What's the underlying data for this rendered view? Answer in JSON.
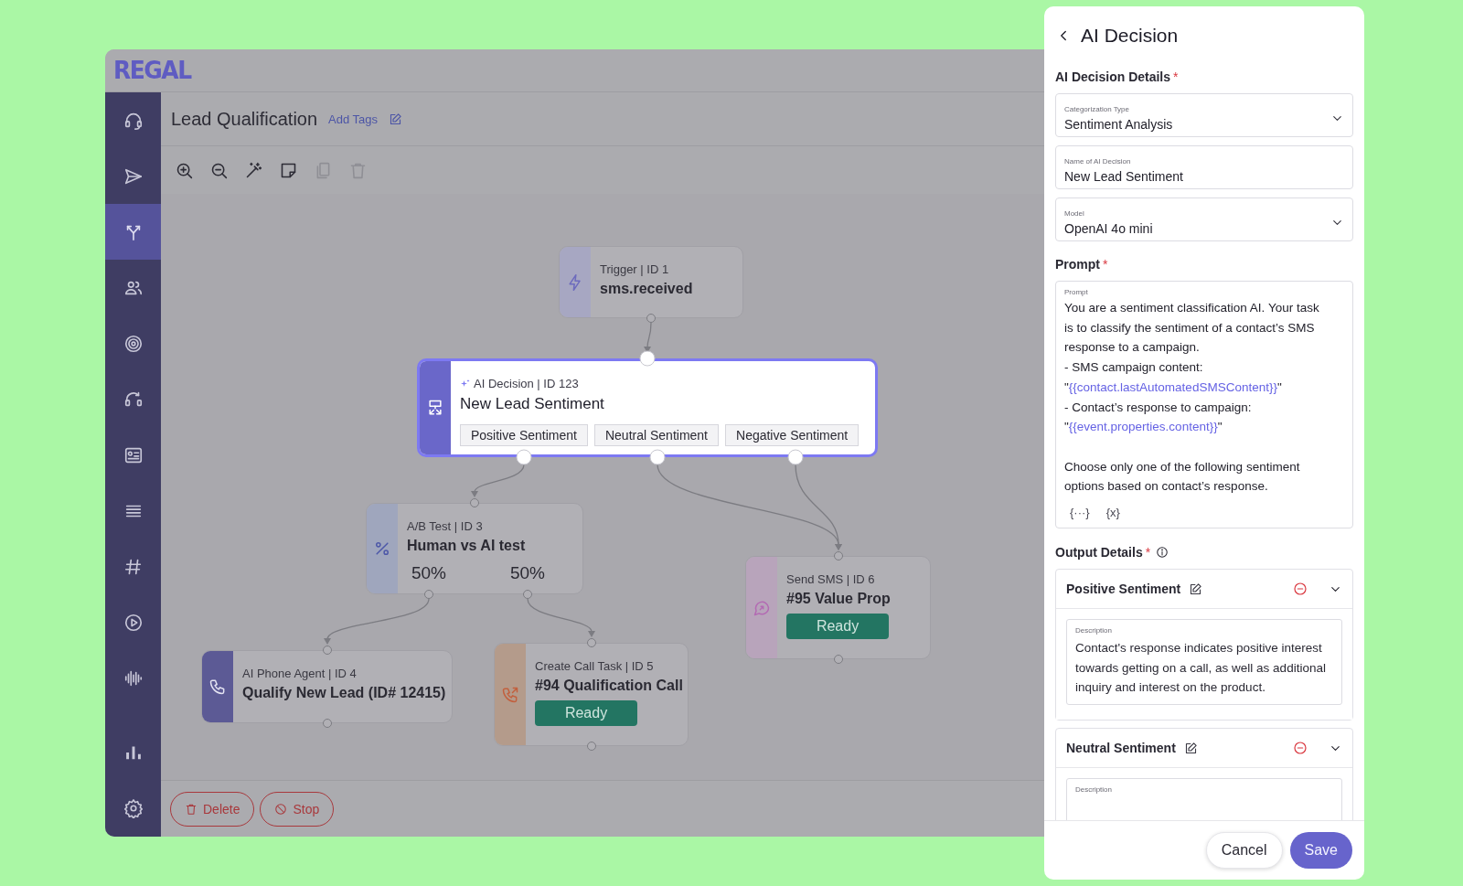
{
  "header": {
    "logo": "REGAL"
  },
  "sidebar": {
    "items": [
      {
        "selected": false
      },
      {
        "selected": false
      },
      {
        "selected": true
      },
      {
        "selected": false
      },
      {
        "selected": false
      },
      {
        "selected": false
      },
      {
        "selected": false
      },
      {
        "selected": false
      },
      {
        "selected": false
      },
      {
        "selected": false
      },
      {
        "selected": false
      }
    ],
    "bottom_items": [
      {
        "selected": false
      },
      {
        "selected": false
      }
    ]
  },
  "flow": {
    "title": "Lead Qualification",
    "tags_link": "Add Tags"
  },
  "toolbar": [
    {
      "disabled": false
    },
    {
      "disabled": false
    },
    {
      "disabled": false
    },
    {
      "disabled": false
    },
    {
      "disabled": true
    },
    {
      "disabled": true
    }
  ],
  "nodes": [
    {
      "kind": "trigger",
      "header": "Trigger | ID 1",
      "title": "sms.received",
      "selected": false
    },
    {
      "kind": "ai_decision",
      "header": "AI Decision | ID 123",
      "title": "New Lead Sentiment",
      "selected": true,
      "outputs": [
        {
          "label": "Positive Sentiment"
        },
        {
          "label": "Neutral Sentiment"
        },
        {
          "label": "Negative Sentiment"
        }
      ]
    },
    {
      "kind": "ab_test",
      "header": "A/B Test | ID 3",
      "title": "Human vs AI test",
      "selected": false,
      "outputs": [
        {
          "label": "50%"
        },
        {
          "label": "50%"
        }
      ]
    },
    {
      "kind": "send_sms",
      "header": "Send SMS | ID 6",
      "title": "#95 Value Prop",
      "status": "Ready",
      "selected": false
    },
    {
      "kind": "phone_agent",
      "header": "AI Phone Agent | ID 4",
      "title": "Qualify New Lead (ID# 12415)",
      "selected": false
    },
    {
      "kind": "call_task",
      "header": "Create Call Task | ID 5",
      "title": "#94 Qualification Call",
      "status": "Ready",
      "selected": false
    }
  ],
  "footer_buttons": [
    {
      "kind": "delete",
      "label": "Delete"
    },
    {
      "kind": "stop",
      "label": "Stop"
    }
  ],
  "panel": {
    "title": "AI Decision",
    "details_heading": {
      "text": "AI Decision Details",
      "mark": "*"
    },
    "fields": [
      {
        "kind": "select",
        "label": "Categorization Type",
        "value": "Sentiment Analysis"
      },
      {
        "kind": "text",
        "label": "Name of AI Decision",
        "value": "New Lead Sentiment"
      },
      {
        "kind": "select",
        "label": "Model",
        "value": "OpenAI 4o mini"
      }
    ],
    "prompt_heading": {
      "text": "Prompt",
      "mark": "*"
    },
    "prompt": {
      "label": "Prompt",
      "lines": [
        {
          "segments": [
            {
              "text": "You are a sentiment classification AI. Your task is to classify the sentiment of a contact’s SMS response to a campaign."
            }
          ]
        },
        {
          "segments": [
            {
              "text": "- SMS campaign content:"
            }
          ]
        },
        {
          "segments": [
            {
              "text": "\""
            },
            {
              "text": "{{contact.lastAutomatedSMSContent}}",
              "kind": "variable"
            },
            {
              "text": "\""
            }
          ]
        },
        {
          "segments": [
            {
              "text": "- Contact’s response to campaign:"
            }
          ]
        },
        {
          "segments": [
            {
              "text": "\""
            },
            {
              "text": "{{event.properties.content}}",
              "kind": "variable"
            },
            {
              "text": "\""
            }
          ]
        },
        {
          "segments": [
            {
              "text": "Choose only one of the following sentiment options based on contact’s response."
            }
          ],
          "blank_line_before": true
        }
      ],
      "tools": [
        "{···}",
        "{x}"
      ]
    },
    "output_heading": {
      "text": "Output Details",
      "mark": "*"
    },
    "outputs": [
      {
        "name": "Positive Sentiment",
        "expanded": true,
        "description_label": "Description",
        "description": "Contact's response indicates positive interest towards getting on a call, as well as additional inquiry and interest on the product."
      },
      {
        "name": "Neutral Sentiment",
        "expanded": true,
        "description_label": "Description"
      }
    ],
    "buttons": [
      {
        "kind": "secondary",
        "label": "Cancel"
      },
      {
        "kind": "primary",
        "label": "Save"
      }
    ]
  }
}
